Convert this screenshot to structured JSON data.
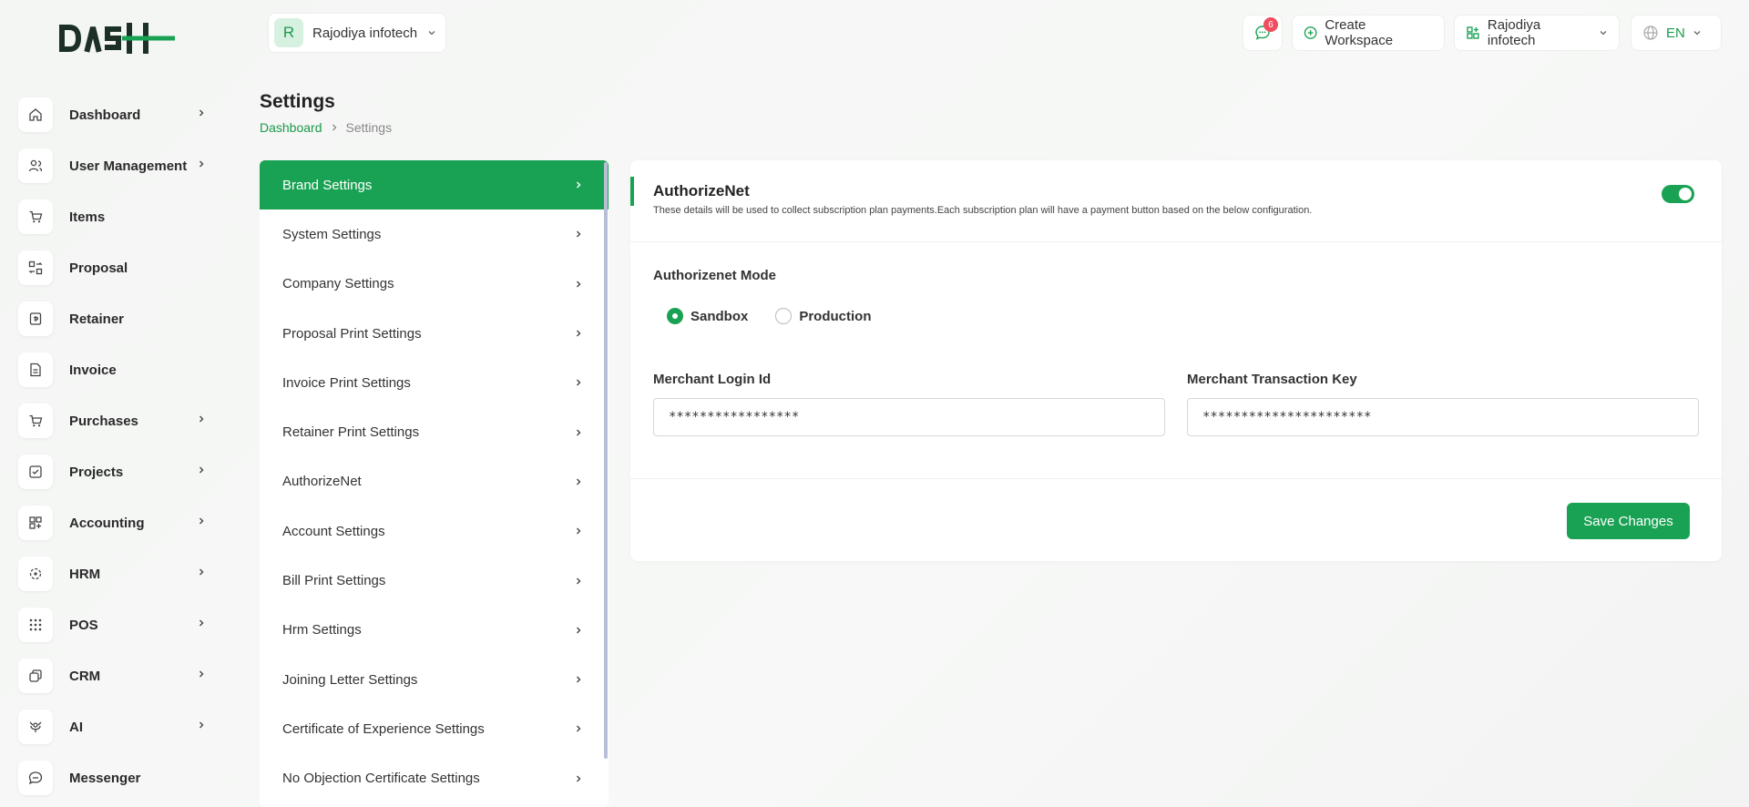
{
  "brand": {
    "logo_text": "DASH",
    "accent": "#1aa254"
  },
  "header": {
    "workspace_initial": "R",
    "workspace_name": "Rajodiya infotech",
    "messages_count": "6",
    "create_workspace": "Create Workspace",
    "user_name": "Rajodiya infotech",
    "language": "EN"
  },
  "sidebar": {
    "items": [
      {
        "label": "Dashboard",
        "icon": "home-icon",
        "has_arrow": true
      },
      {
        "label": "User Management",
        "icon": "users-icon",
        "has_arrow": true
      },
      {
        "label": "Items",
        "icon": "cart-icon",
        "has_arrow": false
      },
      {
        "label": "Proposal",
        "icon": "proposal-icon",
        "has_arrow": false
      },
      {
        "label": "Retainer",
        "icon": "retainer-icon",
        "has_arrow": false
      },
      {
        "label": "Invoice",
        "icon": "invoice-icon",
        "has_arrow": false
      },
      {
        "label": "Purchases",
        "icon": "purchases-icon",
        "has_arrow": true
      },
      {
        "label": "Projects",
        "icon": "projects-icon",
        "has_arrow": true
      },
      {
        "label": "Accounting",
        "icon": "accounting-icon",
        "has_arrow": true
      },
      {
        "label": "HRM",
        "icon": "hrm-icon",
        "has_arrow": true
      },
      {
        "label": "POS",
        "icon": "pos-icon",
        "has_arrow": true
      },
      {
        "label": "CRM",
        "icon": "crm-icon",
        "has_arrow": true
      },
      {
        "label": "AI",
        "icon": "ai-icon",
        "has_arrow": true
      },
      {
        "label": "Messenger",
        "icon": "messenger-icon",
        "has_arrow": false
      }
    ]
  },
  "page": {
    "title": "Settings",
    "breadcrumb": {
      "home": "Dashboard",
      "current": "Settings"
    }
  },
  "settings_menu": {
    "items": [
      {
        "label": "Brand Settings",
        "active": true
      },
      {
        "label": "System Settings"
      },
      {
        "label": "Company Settings"
      },
      {
        "label": "Proposal Print Settings"
      },
      {
        "label": "Invoice Print Settings"
      },
      {
        "label": "Retainer Print Settings"
      },
      {
        "label": "AuthorizeNet"
      },
      {
        "label": "Account Settings"
      },
      {
        "label": "Bill Print Settings"
      },
      {
        "label": "Hrm Settings"
      },
      {
        "label": "Joining Letter Settings"
      },
      {
        "label": "Certificate of Experience Settings"
      },
      {
        "label": "No Objection Certificate Settings"
      }
    ]
  },
  "card": {
    "title": "AuthorizeNet",
    "description": "These details will be used to collect subscription plan payments.Each subscription plan will have a payment button based on the below configuration.",
    "enabled": true,
    "mode_label": "Authorizenet Mode",
    "mode_options": [
      "Sandbox",
      "Production"
    ],
    "mode_selected": "Sandbox",
    "merchant_login_label": "Merchant Login Id",
    "merchant_login_value": "*****************",
    "merchant_key_label": "Merchant Transaction Key",
    "merchant_key_value": "**********************",
    "save_label": "Save Changes"
  }
}
